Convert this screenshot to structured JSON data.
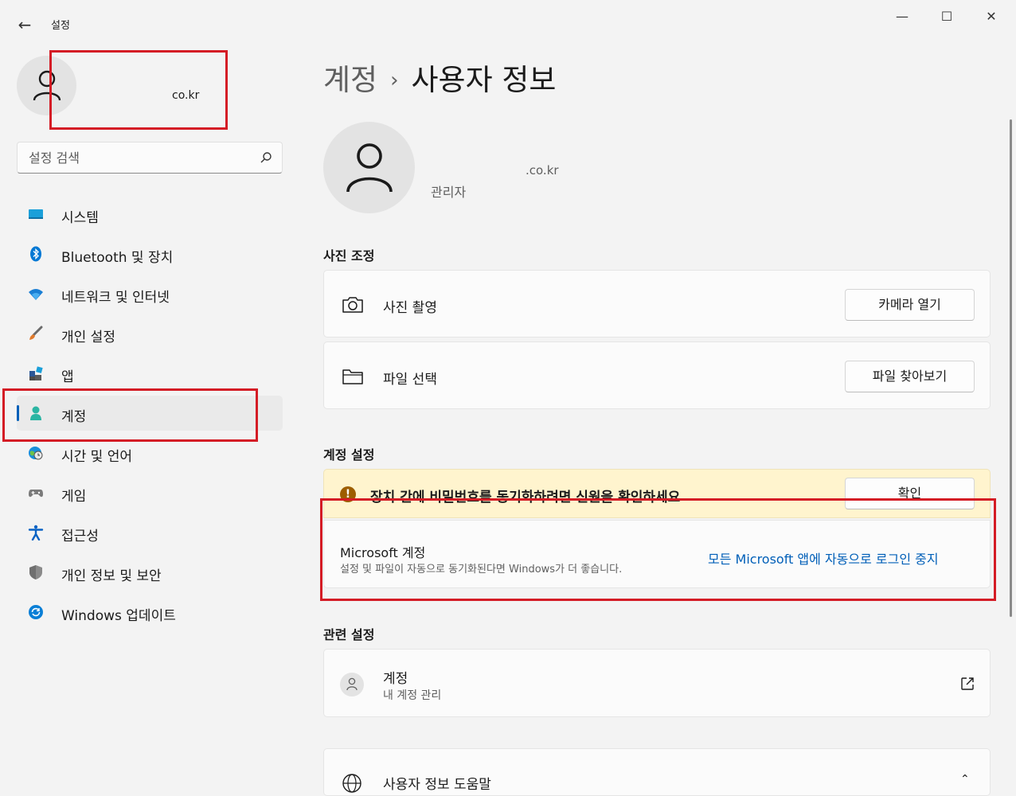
{
  "window": {
    "title": "설정",
    "controls": {
      "minimize": "—",
      "maximize": "☐",
      "close": "✕"
    }
  },
  "profile": {
    "email_partial": "co.kr"
  },
  "search": {
    "placeholder": "설정 검색"
  },
  "sidebar": {
    "items": [
      {
        "label": "시스템",
        "icon": "system-icon",
        "selected": false
      },
      {
        "label": "Bluetooth 및 장치",
        "icon": "bluetooth-icon",
        "selected": false
      },
      {
        "label": "네트워크 및 인터넷",
        "icon": "wifi-icon",
        "selected": false
      },
      {
        "label": "개인 설정",
        "icon": "brush-icon",
        "selected": false
      },
      {
        "label": "앱",
        "icon": "apps-icon",
        "selected": false
      },
      {
        "label": "계정",
        "icon": "account-icon",
        "selected": true
      },
      {
        "label": "시간 및 언어",
        "icon": "globe-clock-icon",
        "selected": false
      },
      {
        "label": "게임",
        "icon": "gamepad-icon",
        "selected": false
      },
      {
        "label": "접근성",
        "icon": "accessibility-icon",
        "selected": false
      },
      {
        "label": "개인 정보 및 보안",
        "icon": "shield-icon",
        "selected": false
      },
      {
        "label": "Windows 업데이트",
        "icon": "update-icon",
        "selected": false
      }
    ]
  },
  "breadcrumb": {
    "parent": "계정",
    "separator": "›",
    "current": "사용자 정보"
  },
  "user": {
    "email_partial": ".co.kr",
    "role": "관리자"
  },
  "photo_section": {
    "title": "사진 조정",
    "take_photo": {
      "label": "사진 촬영",
      "button": "카메라 열기"
    },
    "choose_file": {
      "label": "파일 선택",
      "button": "파일 찾아보기"
    }
  },
  "account_settings": {
    "title": "계정 설정",
    "warning": {
      "text": "장치 간에 비밀번호를 동기화하려면 신원을 확인하세요",
      "button": "확인"
    },
    "microsoft": {
      "title": "Microsoft 계정",
      "subtitle": "설정 및 파일이 자동으로 동기화된다면 Windows가 더 좋습니다.",
      "link": "모든 Microsoft 앱에 자동으로 로그인 중지"
    }
  },
  "related": {
    "title": "관련 설정",
    "accounts": {
      "title": "계정",
      "subtitle": "내 계정 관리"
    },
    "help": {
      "title": "사용자 정보 도움말"
    }
  },
  "colors": {
    "accent": "#005fb8",
    "highlight_box": "#d41c25",
    "warning_bg": "#fff4ce"
  }
}
